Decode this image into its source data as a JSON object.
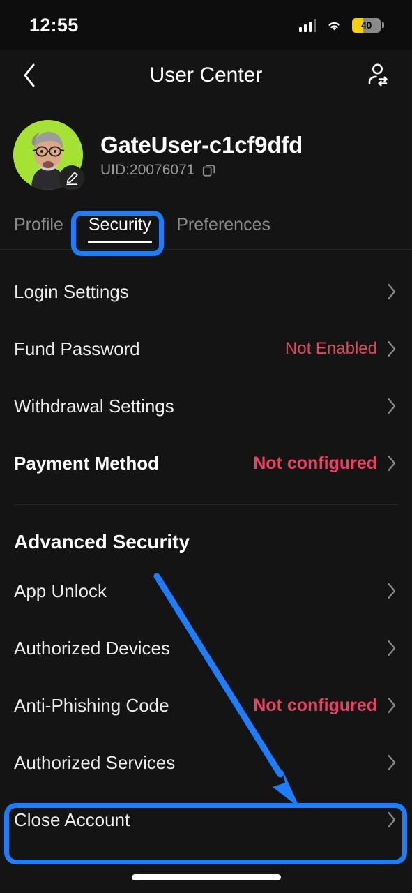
{
  "status_bar": {
    "time": "12:55",
    "battery_percent": "40",
    "battery_level": 40,
    "signal_icon": "cellular-signal-icon",
    "wifi_icon": "wifi-icon",
    "battery_icon": "battery-icon",
    "battery_fill_color": "#f5d000"
  },
  "header": {
    "title": "User Center",
    "back_icon": "chevron-left-icon",
    "switch_account_icon": "switch-account-icon"
  },
  "profile": {
    "username": "GateUser-c1cf9dfd",
    "uid": "UID:20076071",
    "copy_icon": "copy-icon",
    "edit_icon": "pencil-edit-icon",
    "avatar_bg_color": "#a6e234"
  },
  "tabs": [
    {
      "label": "Profile",
      "active": false
    },
    {
      "label": "Security",
      "active": true
    },
    {
      "label": "Preferences",
      "active": false
    }
  ],
  "security_list": [
    {
      "label": "Login Settings",
      "status": "",
      "bold": false
    },
    {
      "label": "Fund Password",
      "status": "Not Enabled",
      "bold": false
    },
    {
      "label": "Withdrawal Settings",
      "status": "",
      "bold": false
    },
    {
      "label": "Payment Method",
      "status": "Not configured",
      "bold": true
    }
  ],
  "advanced_section": {
    "title": "Advanced Security",
    "items": [
      {
        "label": "App Unlock",
        "status": "",
        "bold": false
      },
      {
        "label": "Authorized Devices",
        "status": "",
        "bold": false
      },
      {
        "label": "Anti-Phishing Code",
        "status": "Not configured",
        "bold": true
      },
      {
        "label": "Authorized Services",
        "status": "",
        "bold": false
      },
      {
        "label": "Close Account",
        "status": "",
        "bold": false
      }
    ]
  },
  "annotations": {
    "highlight_color": "#1d7dfb",
    "tab_highlight_target": "Security",
    "row_highlight_target": "Close Account",
    "arrow": "blue-arrow-pointing-to-close-account"
  },
  "colors": {
    "background": "#141414",
    "text_primary": "#ececec",
    "text_muted": "#8c8c8c",
    "status_red": "#e0465c",
    "status_red_bold": "#ee3f63",
    "chevron": "#8a8a8a"
  }
}
